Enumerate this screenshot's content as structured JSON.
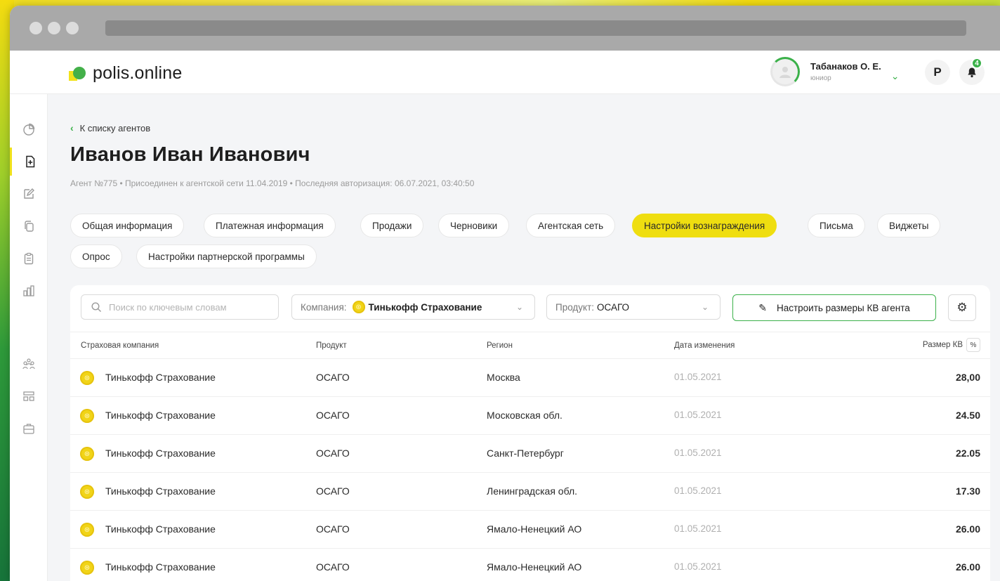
{
  "app": {
    "logo_text": "polis.online",
    "brand_colors": {
      "yellow": "#efde10",
      "green": "#3bb14a"
    }
  },
  "user": {
    "name": "Табанаков О. Е.",
    "role": "юниор",
    "currency_icon": "Р",
    "notifications_count": "4"
  },
  "sidebar": {
    "items": [
      {
        "icon": "pie-chart-icon",
        "active": false
      },
      {
        "icon": "document-plus-icon",
        "active": true
      },
      {
        "icon": "edit-icon",
        "active": false
      },
      {
        "icon": "copy-icon",
        "active": false
      },
      {
        "icon": "clipboard-icon",
        "active": false
      },
      {
        "icon": "bar-chart-icon",
        "active": false
      },
      {
        "icon": "people-icon",
        "active": false
      },
      {
        "icon": "layout-icon",
        "active": false
      },
      {
        "icon": "briefcase-icon",
        "active": false
      }
    ]
  },
  "page": {
    "back_link": "К списку агентов",
    "title": "Иванов Иван Иванович",
    "meta": "Агент №775 • Присоединен к агентской сети 11.04.2019 • Последняя авторизация: 06.07.2021, 03:40:50"
  },
  "tabs": [
    {
      "label": "Общая информация",
      "active": false
    },
    {
      "label": "Платежная информация",
      "active": false
    },
    {
      "label": "Продажи",
      "active": false
    },
    {
      "label": "Черновики",
      "active": false
    },
    {
      "label": "Агентская сеть",
      "active": false
    },
    {
      "label": "Настройки вознаграждения",
      "active": true
    },
    {
      "label": "Письма",
      "active": false
    },
    {
      "label": "Виджеты",
      "active": false
    },
    {
      "label": "Опрос",
      "active": false
    },
    {
      "label": "Настройки партнерской программы",
      "active": false
    }
  ],
  "filters": {
    "search_placeholder": "Поиск по ключевым словам",
    "company_label": "Компания:",
    "company_value": "Тинькофф Страхование",
    "product_label": "Продукт:",
    "product_value": "ОСАГО",
    "configure_button": "Настроить размеры КВ агента"
  },
  "table": {
    "columns": [
      "Страховая компания",
      "Продукт",
      "Регион",
      "Дата изменения",
      "Размер КВ",
      "%"
    ],
    "rows": [
      {
        "company": "Тинькофф Страхование",
        "product": "ОСАГО",
        "region": "Москва",
        "date": "01.05.2021",
        "kv": "28,00"
      },
      {
        "company": "Тинькофф Страхование",
        "product": "ОСАГО",
        "region": "Московская обл.",
        "date": "01.05.2021",
        "kv": "24.50"
      },
      {
        "company": "Тинькофф Страхование",
        "product": "ОСАГО",
        "region": "Санкт-Петербург",
        "date": "01.05.2021",
        "kv": "22.05"
      },
      {
        "company": "Тинькофф Страхование",
        "product": "ОСАГО",
        "region": "Ленинградская обл.",
        "date": "01.05.2021",
        "kv": "17.30"
      },
      {
        "company": "Тинькофф Страхование",
        "product": "ОСАГО",
        "region": "Ямало-Ненецкий АО",
        "date": "01.05.2021",
        "kv": "26.00"
      },
      {
        "company": "Тинькофф Страхование",
        "product": "ОСАГО",
        "region": "Ямало-Ненецкий АО",
        "date": "01.05.2021",
        "kv": "26.00"
      }
    ]
  }
}
